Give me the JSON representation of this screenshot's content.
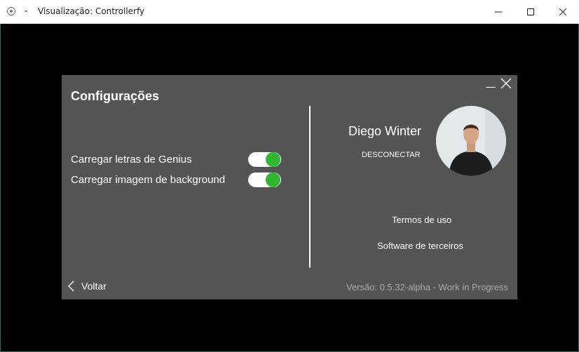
{
  "window": {
    "title": "Visualização: Controllerfy",
    "chevron_icon": "chevron-down-icon",
    "record_icon": "record-icon"
  },
  "panel": {
    "heading": "Configurações",
    "options": [
      {
        "label": "Carregar letras de Genius",
        "enabled": true
      },
      {
        "label": "Carregar imagem de background",
        "enabled": true
      }
    ],
    "user": {
      "name": "Diego Winter",
      "disconnect_label": "DESCONECTAR"
    },
    "links": {
      "terms": "Termos de uso",
      "third_party": "Software de terceiros"
    },
    "back_label": "Voltar",
    "version": "Versão: 0.5.32-alpha - Work in Progress"
  },
  "colors": {
    "panel_bg": "#545454",
    "toggle_on": "#2fb82f",
    "version_text": "#a9a9a9"
  }
}
